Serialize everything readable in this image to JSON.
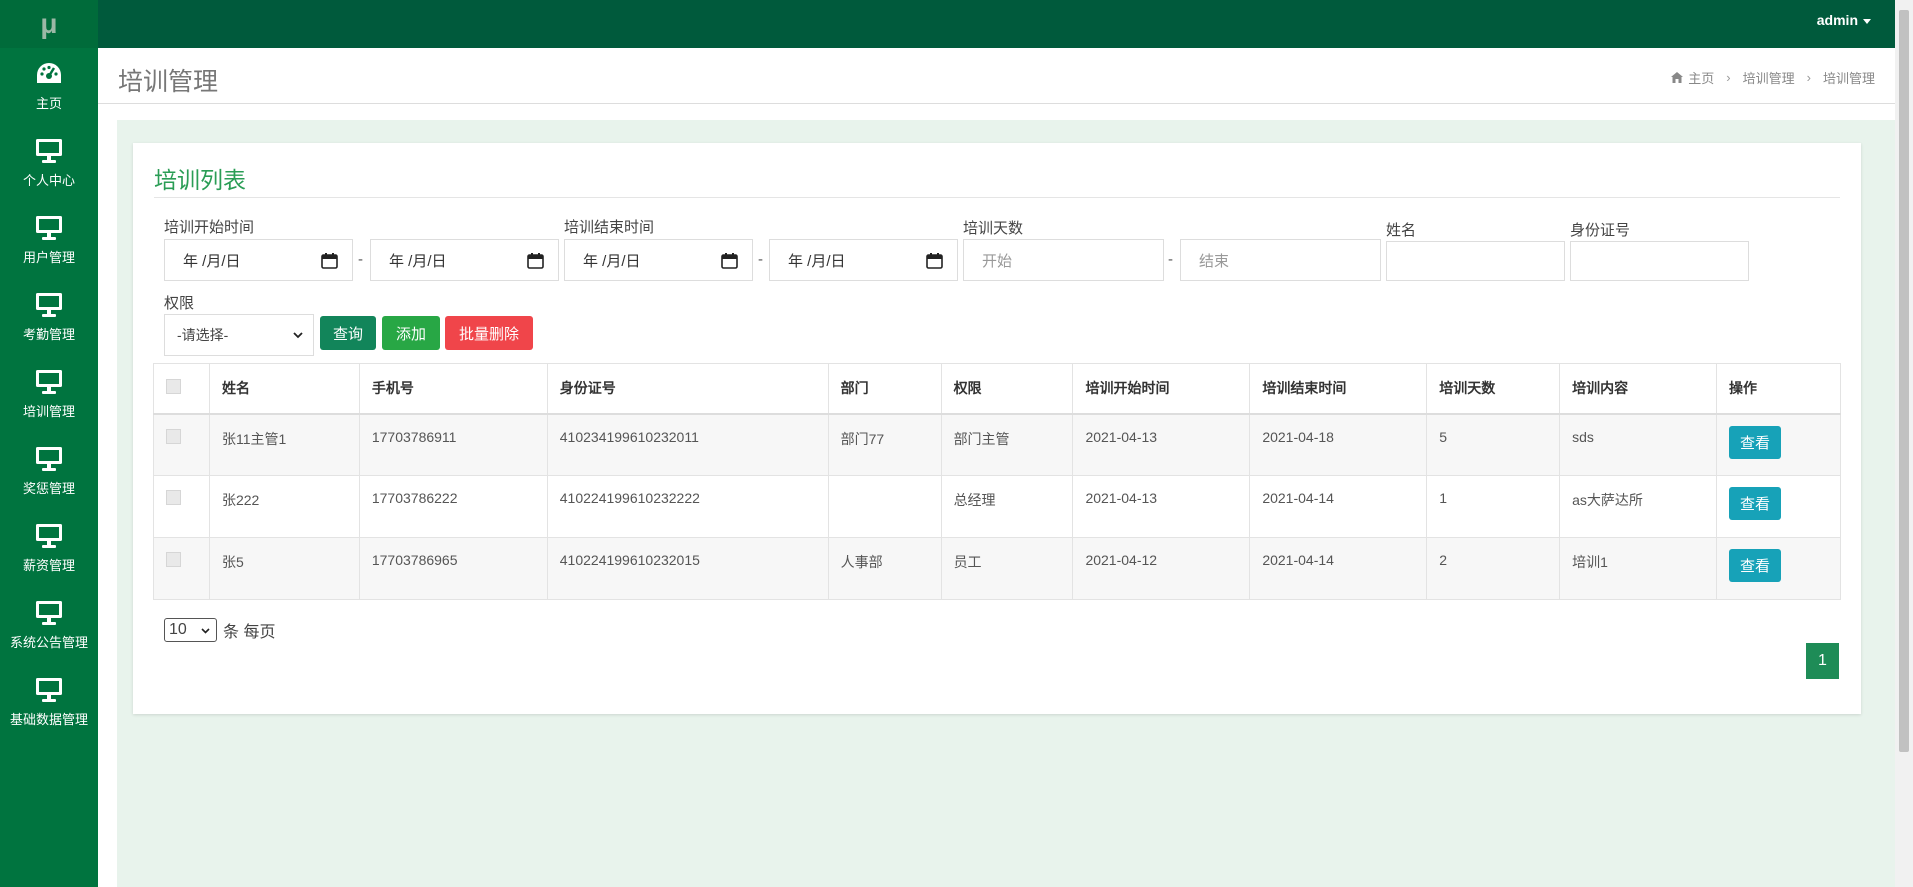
{
  "logo": "μ",
  "sidebar": {
    "items": [
      {
        "label": "主页",
        "icon": "dashboard-icon"
      },
      {
        "label": "个人中心",
        "icon": "monitor-icon"
      },
      {
        "label": "用户管理",
        "icon": "monitor-icon"
      },
      {
        "label": "考勤管理",
        "icon": "monitor-icon"
      },
      {
        "label": "培训管理",
        "icon": "monitor-icon"
      },
      {
        "label": "奖惩管理",
        "icon": "monitor-icon"
      },
      {
        "label": "薪资管理",
        "icon": "monitor-icon"
      },
      {
        "label": "系统公告管理",
        "icon": "monitor-icon"
      },
      {
        "label": "基础数据管理",
        "icon": "monitor-icon"
      }
    ]
  },
  "topbar": {
    "user": "admin"
  },
  "header": {
    "title": "培训管理",
    "breadcrumb": [
      "主页",
      "培训管理",
      "培训管理"
    ]
  },
  "card": {
    "title": "培训列表"
  },
  "filters": {
    "start_time_label": "培训开始时间",
    "end_time_label": "培训结束时间",
    "days_label": "培训天数",
    "name_label": "姓名",
    "id_label": "身份证号",
    "role_label": "权限",
    "date_placeholder": "年 /月/日",
    "dash": "-",
    "days_start_placeholder": "开始",
    "days_end_placeholder": "结束",
    "role_select": "-请选择-"
  },
  "buttons": {
    "query": "查询",
    "add": "添加",
    "batch_delete": "批量删除"
  },
  "table": {
    "headers": [
      "姓名",
      "手机号",
      "身份证号",
      "部门",
      "权限",
      "培训开始时间",
      "培训结束时间",
      "培训天数",
      "培训内容",
      "操作"
    ],
    "rows": [
      [
        "张11主管1",
        "17703786911",
        "410234199610232011",
        "部门77",
        "部门主管",
        "2021-04-13",
        "2021-04-18",
        "5",
        "sds"
      ],
      [
        "张222",
        "17703786222",
        "410224199610232222",
        "",
        "总经理",
        "2021-04-13",
        "2021-04-14",
        "1",
        "as大萨达所"
      ],
      [
        "张5",
        "17703786965",
        "410224199610232015",
        "人事部",
        "员工",
        "2021-04-12",
        "2021-04-14",
        "2",
        "培训1"
      ]
    ],
    "view_label": "查看"
  },
  "pagination": {
    "per_page_value": "10",
    "per_page_suffix": "条 每页",
    "current_page": "1"
  },
  "colors": {
    "sidebar": "#00743f",
    "topbar": "#005a3c",
    "accent": "#2a9d55",
    "danger": "#f0454a",
    "info": "#17a2b8"
  }
}
